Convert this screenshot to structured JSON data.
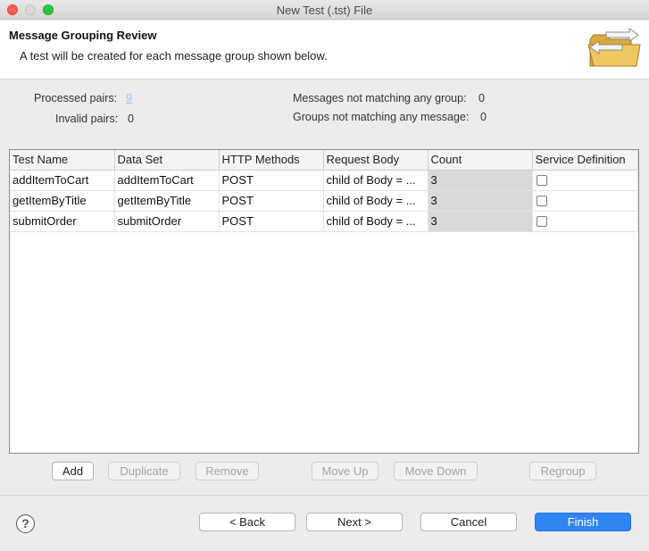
{
  "window": {
    "title": "New Test (.tst) File"
  },
  "banner": {
    "title": "Message Grouping Review",
    "description": "A test will be created for each message group shown below.",
    "icon": "folder-arrows-icon"
  },
  "stats": {
    "processed_pairs_label": "Processed pairs:",
    "processed_pairs_value": "9",
    "invalid_pairs_label": "Invalid pairs:",
    "invalid_pairs_value": "0",
    "messages_not_matching_label": "Messages not matching any group:",
    "messages_not_matching_value": "0",
    "groups_not_matching_label": "Groups not matching any message:",
    "groups_not_matching_value": "0"
  },
  "table": {
    "columns": [
      "Test Name",
      "Data Set",
      "HTTP Methods",
      "Request Body",
      "Count",
      "Service Definition"
    ],
    "rows": [
      {
        "test_name": "addItemToCart",
        "data_set": "addItemToCart",
        "http_methods": "POST",
        "request_body": "child of Body = ...",
        "count": "3",
        "service_definition": false
      },
      {
        "test_name": "getItemByTitle",
        "data_set": "getItemByTitle",
        "http_methods": "POST",
        "request_body": "child of Body = ...",
        "count": "3",
        "service_definition": false
      },
      {
        "test_name": "submitOrder",
        "data_set": "submitOrder",
        "http_methods": "POST",
        "request_body": "child of Body = ...",
        "count": "3",
        "service_definition": false
      }
    ]
  },
  "table_buttons": {
    "add": "Add",
    "duplicate": "Duplicate",
    "remove": "Remove",
    "move_up": "Move Up",
    "move_down": "Move Down",
    "regroup": "Regroup"
  },
  "footer": {
    "help": "?",
    "back": "< Back",
    "next": "Next >",
    "cancel": "Cancel",
    "finish": "Finish"
  },
  "colors": {
    "primary_button": "#2f86f3",
    "count_cell_bg": "#d9d9d9",
    "link": "#9ec2ea"
  }
}
